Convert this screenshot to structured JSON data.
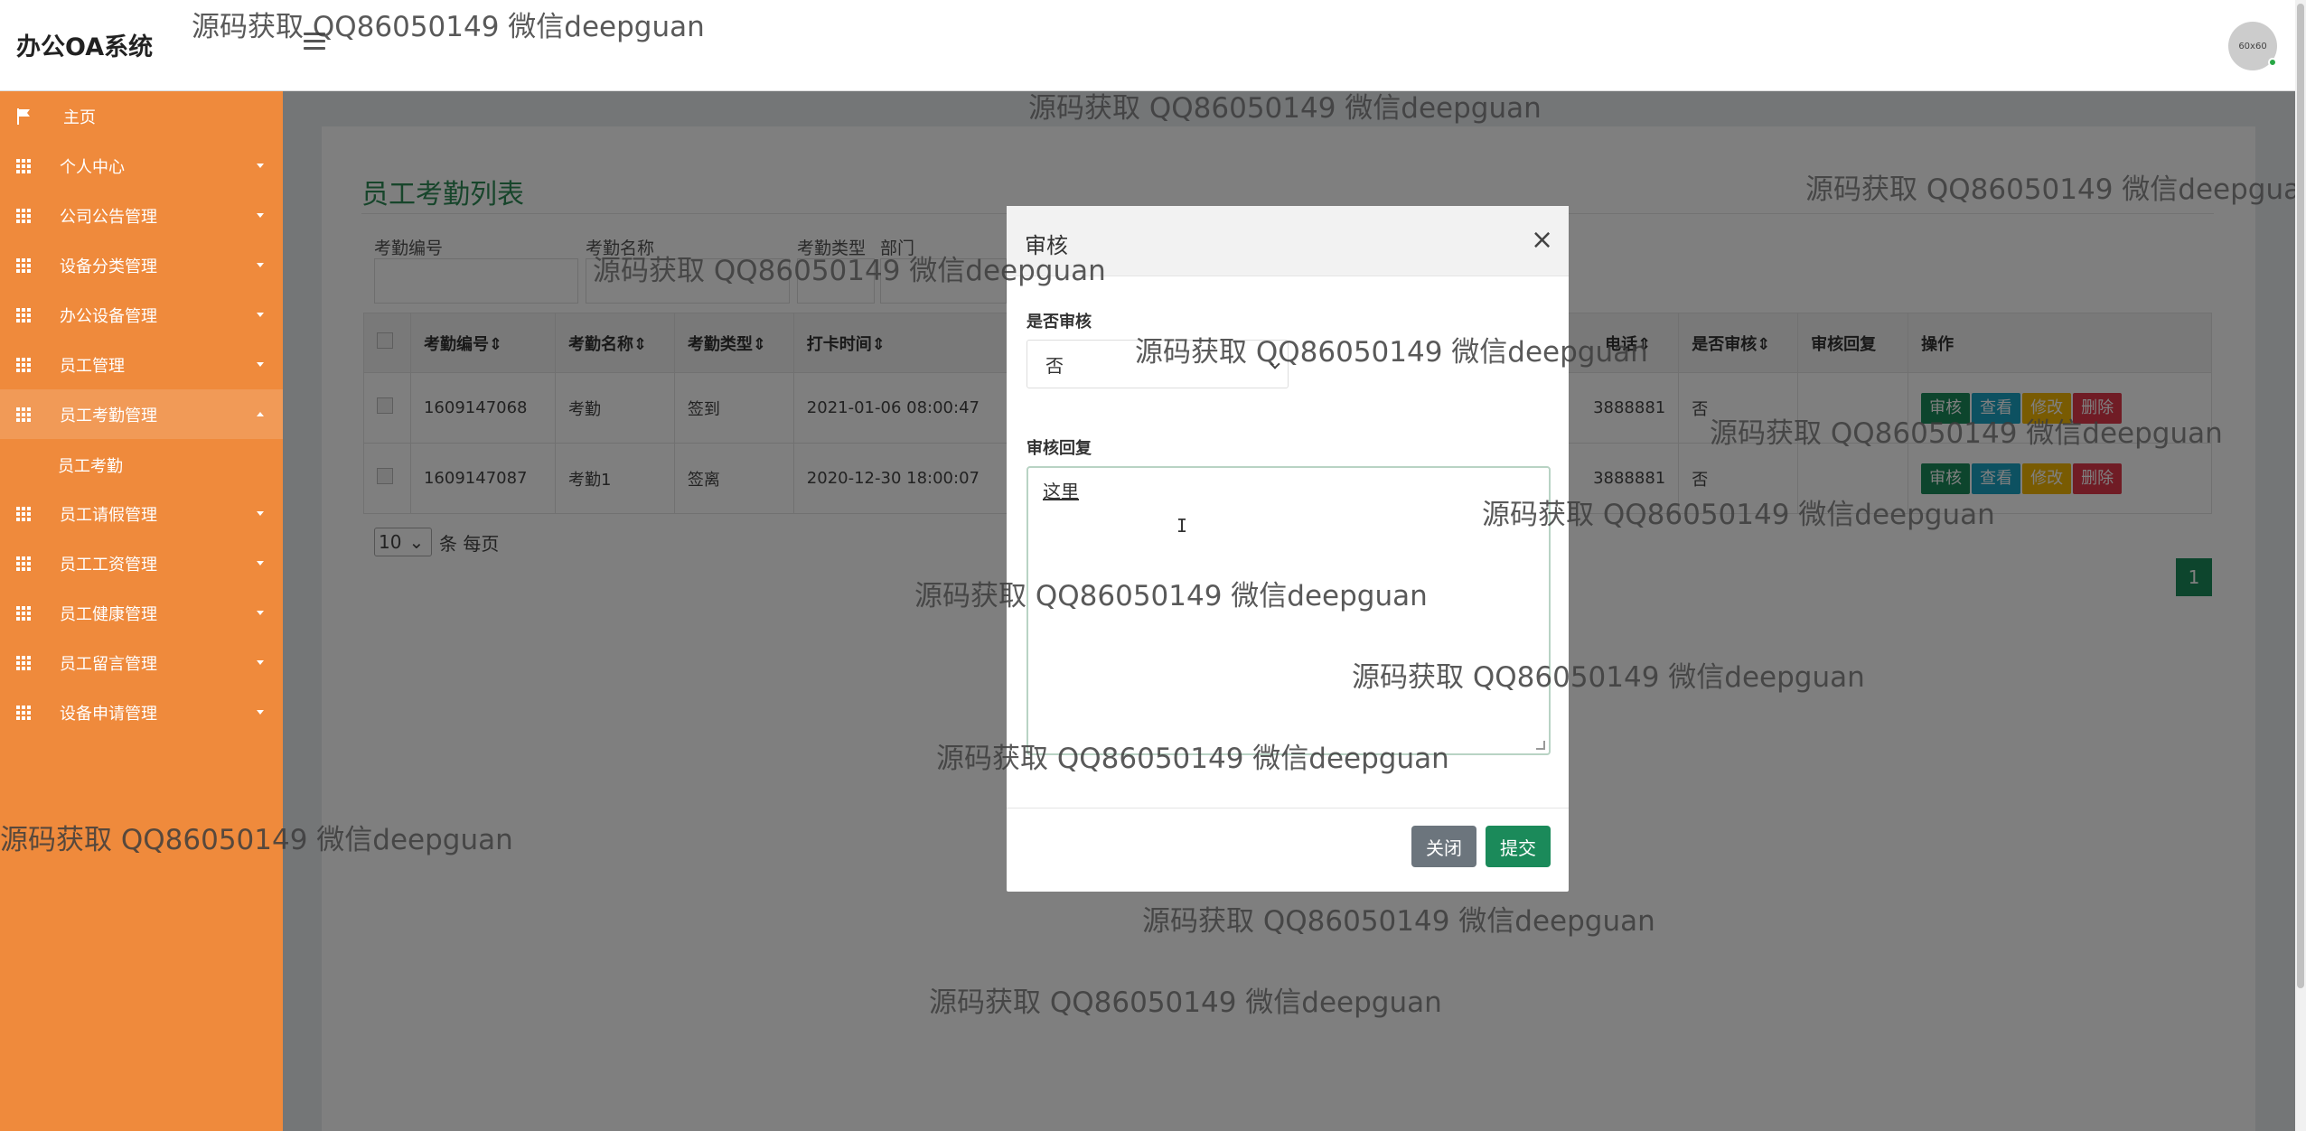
{
  "app": {
    "title": "办公OA系统",
    "avatar_text": "60x60"
  },
  "sidebar": {
    "home": "主页",
    "items": [
      {
        "label": "个人中心"
      },
      {
        "label": "公司公告管理"
      },
      {
        "label": "设备分类管理"
      },
      {
        "label": "办公设备管理"
      },
      {
        "label": "员工管理"
      },
      {
        "label": "员工考勤管理"
      },
      {
        "label": "员工请假管理"
      },
      {
        "label": "员工工资管理"
      },
      {
        "label": "员工健康管理"
      },
      {
        "label": "员工留言管理"
      },
      {
        "label": "设备申请管理"
      }
    ],
    "sub_item": "员工考勤"
  },
  "page": {
    "title": "员工考勤列表",
    "filters": {
      "code": "考勤编号",
      "name": "考勤名称",
      "type": "考勤类型",
      "dept": "部门"
    },
    "table": {
      "headers": [
        "考勤编号",
        "考勤名称",
        "考勤类型",
        "打卡时间",
        "电话",
        "是否审核",
        "审核回复",
        "操作"
      ],
      "rows": [
        {
          "code": "1609147068",
          "name": "考勤",
          "type": "签到",
          "time": "2021-01-06 08:00:47",
          "phone": "3888881",
          "reviewed": "否",
          "reply": ""
        },
        {
          "code": "1609147087",
          "name": "考勤1",
          "type": "签离",
          "time": "2020-12-30 18:00:07",
          "phone": "3888881",
          "reviewed": "否",
          "reply": ""
        }
      ],
      "actions": {
        "review": "审核",
        "view": "查看",
        "edit": "修改",
        "delete": "删除"
      }
    },
    "per_page": {
      "value": "10",
      "suffix": "条 每页"
    },
    "page_number": "1"
  },
  "modal": {
    "title": "审核",
    "close_symbol": "×",
    "review_label": "是否审核",
    "review_value": "否",
    "reply_label": "审核回复",
    "reply_value": "这里",
    "close_button": "关闭",
    "submit_button": "提交"
  },
  "watermark": "源码获取 QQ86050149 微信deepguan"
}
